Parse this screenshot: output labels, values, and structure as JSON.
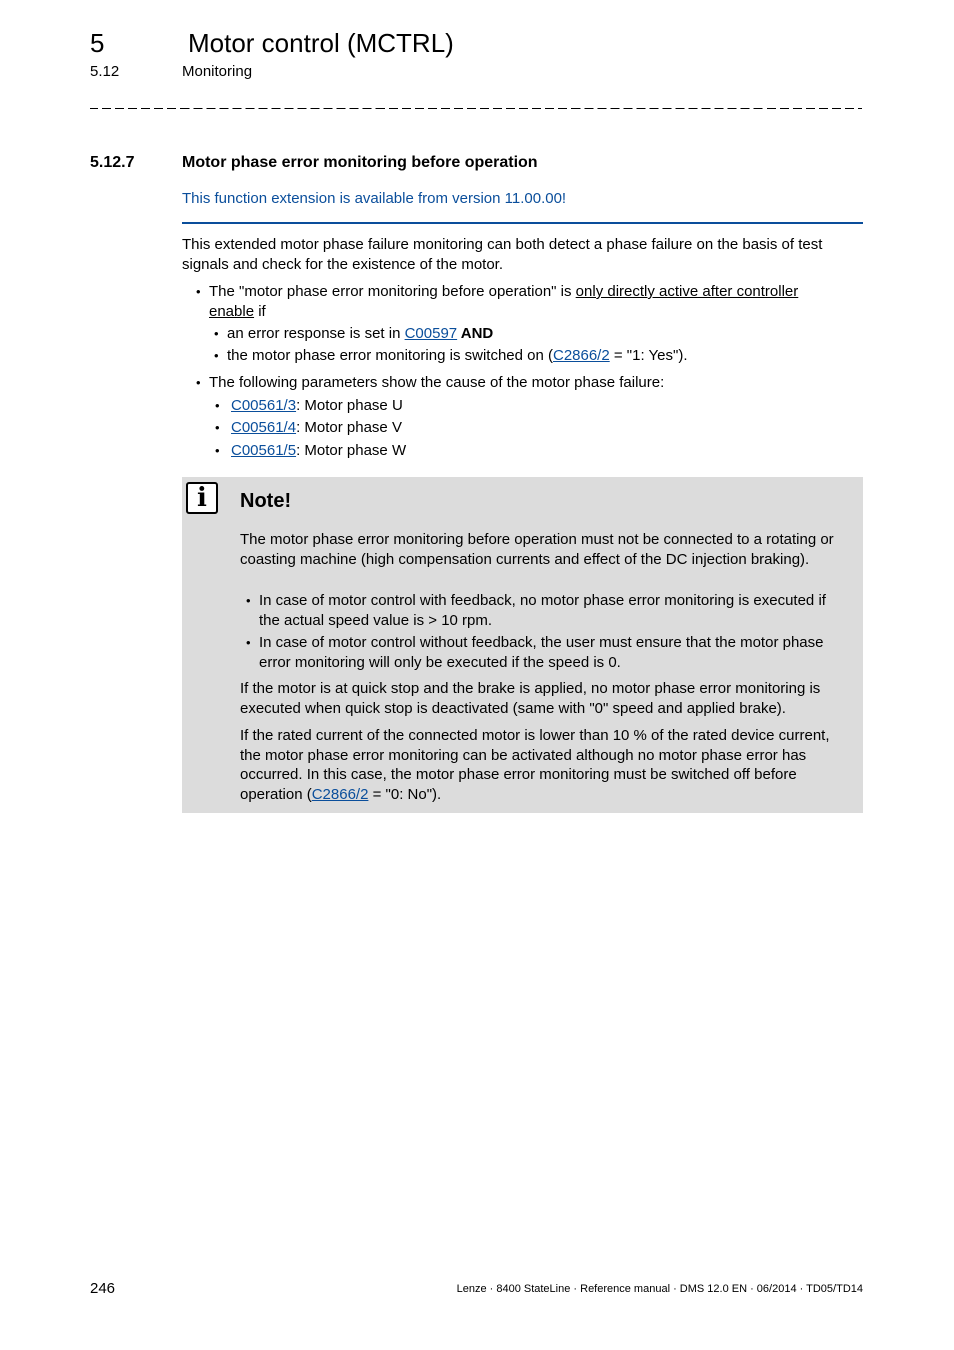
{
  "header": {
    "chapter_number": "5",
    "chapter_title": "Motor control (MCTRL)",
    "section_number": "5.12",
    "section_title": "Monitoring"
  },
  "subsection": {
    "number": "5.12.7",
    "title": "Motor phase error monitoring before operation",
    "version_note": "This function extension is available from version 11.00.00!"
  },
  "intro": "This extended motor phase failure monitoring can both detect a phase failure on the basis of test signals and check for the existence of the motor.",
  "bullets": {
    "b1_prefix": "The \"motor phase error monitoring before operation\" is ",
    "b1_underlined_1": "only directly active after controller ",
    "b1_underlined_2": "enable",
    "b1_suffix": " if",
    "b1_sub1_text": "an error response is set in ",
    "b1_sub1_link": "C00597",
    "b1_sub1_bold": " AND",
    "b1_sub2_text": "the motor phase error monitoring is switched on (",
    "b1_sub2_link": "C2866/2",
    "b1_sub2_suffix": " = \"1: Yes\").",
    "b2_text": "The following parameters show the cause of the motor phase failure:",
    "params": [
      {
        "link": "C00561/3",
        "label": ": Motor phase U"
      },
      {
        "link": "C00561/4",
        "label": ": Motor phase V"
      },
      {
        "link": "C00561/5",
        "label": ": Motor phase W"
      }
    ]
  },
  "note": {
    "icon": "info-icon",
    "title": "Note!",
    "p1": "The motor phase error monitoring before operation must not be connected to a rotating or coasting machine (high compensation currents and effect of the DC injection braking).",
    "bullet1": "In case of motor control with feedback, no motor phase error monitoring is executed if the actual speed value is > 10 rpm.",
    "bullet2": "In case of motor control without feedback, the user must ensure that the motor phase error monitoring will only be executed if the speed is 0.",
    "p2": "If the motor is at quick stop and the brake is applied, no motor phase error monitoring is executed when quick stop is deactivated (same with \"0\" speed and applied brake).",
    "p3_text": "If the rated current of the connected motor is lower than 10 % of the rated device current, the motor phase error monitoring can be activated although no motor phase error has occurred. In this case, the motor phase error monitoring must be switched off before operation (",
    "p3_link": "C2866/2",
    "p3_suffix": " = \"0: No\")."
  },
  "footer": {
    "page_number": "246",
    "info": "Lenze · 8400 StateLine · Reference manual · DMS 12.0 EN · 06/2014 · TD05/TD14"
  },
  "colors": {
    "link": "#0a4e9b",
    "note_background": "#dcdcdc"
  }
}
